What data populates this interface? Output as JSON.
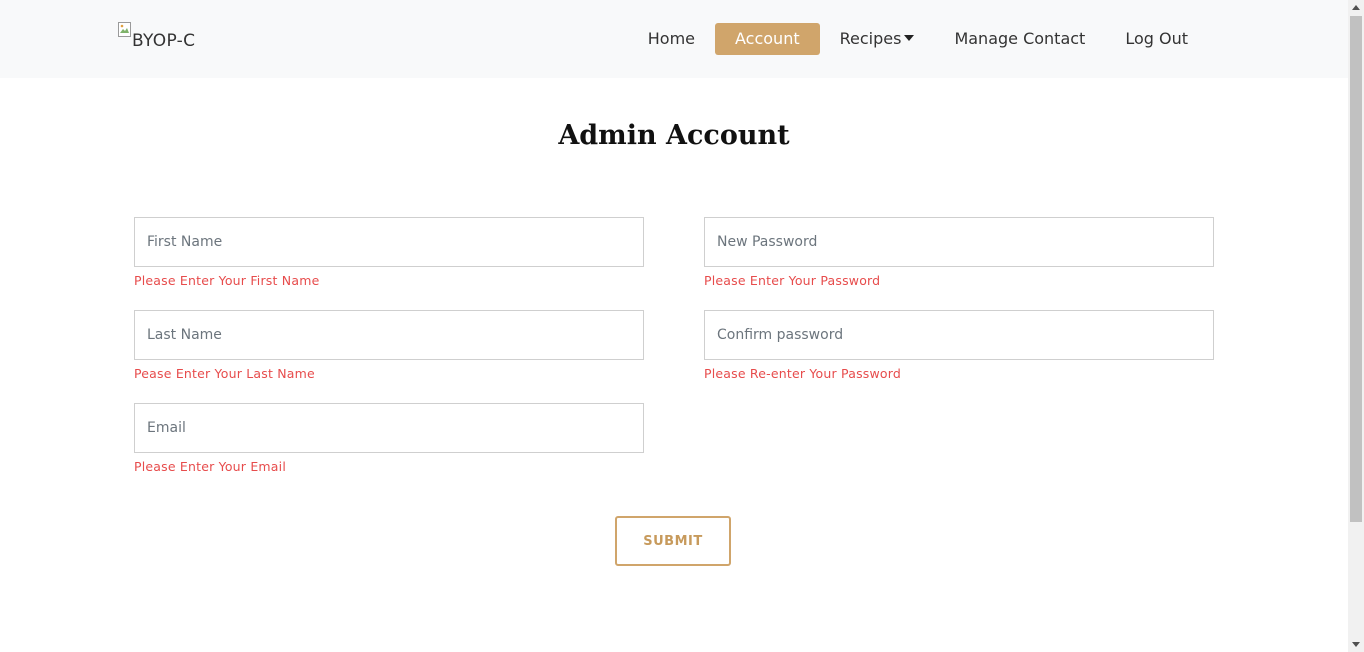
{
  "navbar": {
    "brand_alt": "BYOP-C",
    "items": [
      {
        "label": "Home"
      },
      {
        "label": "Account"
      },
      {
        "label": "Recipes"
      },
      {
        "label": "Manage Contact"
      },
      {
        "label": "Log Out"
      }
    ],
    "active_color": "#d0a56b"
  },
  "main": {
    "title": "Admin Account",
    "fields": {
      "first_name": {
        "placeholder": "First Name",
        "value": "",
        "error": "Please Enter Your First Name"
      },
      "new_password": {
        "placeholder": "New Password",
        "value": "",
        "error": "Please Enter Your Password"
      },
      "last_name": {
        "placeholder": "Last Name",
        "value": "",
        "error": "Pease Enter Your Last Name"
      },
      "confirm_password": {
        "placeholder": "Confirm password",
        "value": "",
        "error": "Please Re-enter Your Password"
      },
      "email": {
        "placeholder": "Email",
        "value": "",
        "error": "Please Enter Your Email"
      }
    },
    "submit_label": "SUBMIT",
    "error_color": "#e74c4c"
  }
}
